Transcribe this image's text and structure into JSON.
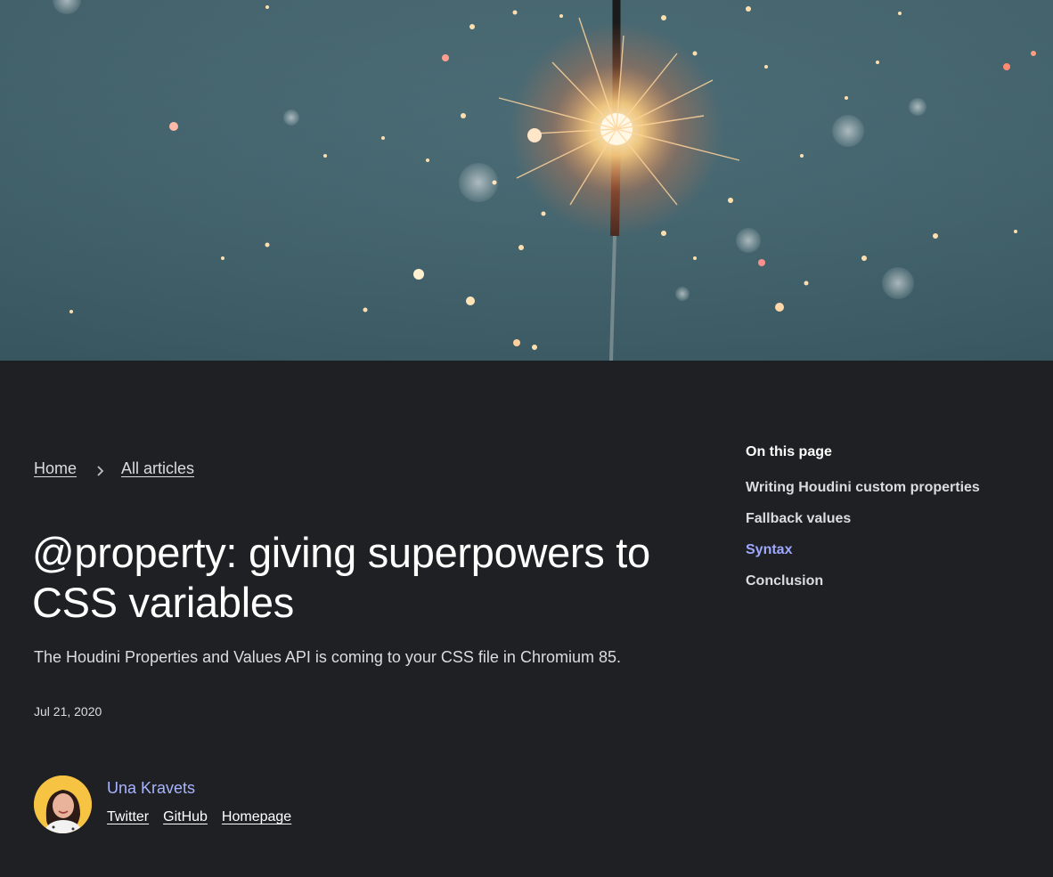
{
  "hero": {
    "image": "sparkler-photo"
  },
  "breadcrumb": {
    "items": [
      "Home",
      "All articles"
    ],
    "separator_icon": "chevron-right-icon"
  },
  "article": {
    "title": "@property: giving superpowers to CSS variables",
    "subtitle": "The Houdini Properties and Values API is coming to your CSS file in Chromium 85.",
    "date": "Jul 21, 2020"
  },
  "author": {
    "name": "Una Kravets",
    "links": [
      "Twitter",
      "GitHub",
      "Homepage"
    ]
  },
  "toc": {
    "heading": "On this page",
    "items": [
      "Writing Houdini custom properties",
      "Fallback values",
      "Syntax",
      "Conclusion"
    ],
    "active_index": 2
  },
  "colors": {
    "background": "#1f2023",
    "accent": "#a8b4ff",
    "active_toc": "#9fa8ff"
  }
}
